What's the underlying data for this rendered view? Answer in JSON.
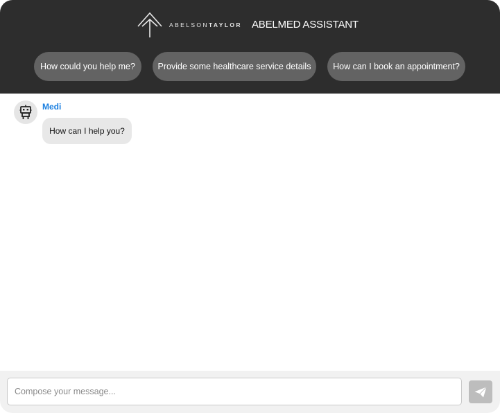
{
  "header": {
    "brand": {
      "name_light": "ABELSON",
      "name_bold": "TAYLOR",
      "logo_icon": "abelson-taylor-logo"
    },
    "title": "ABELMED ASSISTANT",
    "background": "#2d2d2d"
  },
  "suggestions": [
    {
      "label": "How could you help me?"
    },
    {
      "label": "Provide some healthcare service details"
    },
    {
      "label": "How can I book an appointment?"
    }
  ],
  "messages": [
    {
      "sender": "Medi",
      "avatar_icon": "robot-icon",
      "text": "How can I help you?",
      "sender_color": "#1a7fe0"
    }
  ],
  "composer": {
    "placeholder": "Compose your message...",
    "value": "",
    "send_icon": "paper-plane-icon"
  }
}
